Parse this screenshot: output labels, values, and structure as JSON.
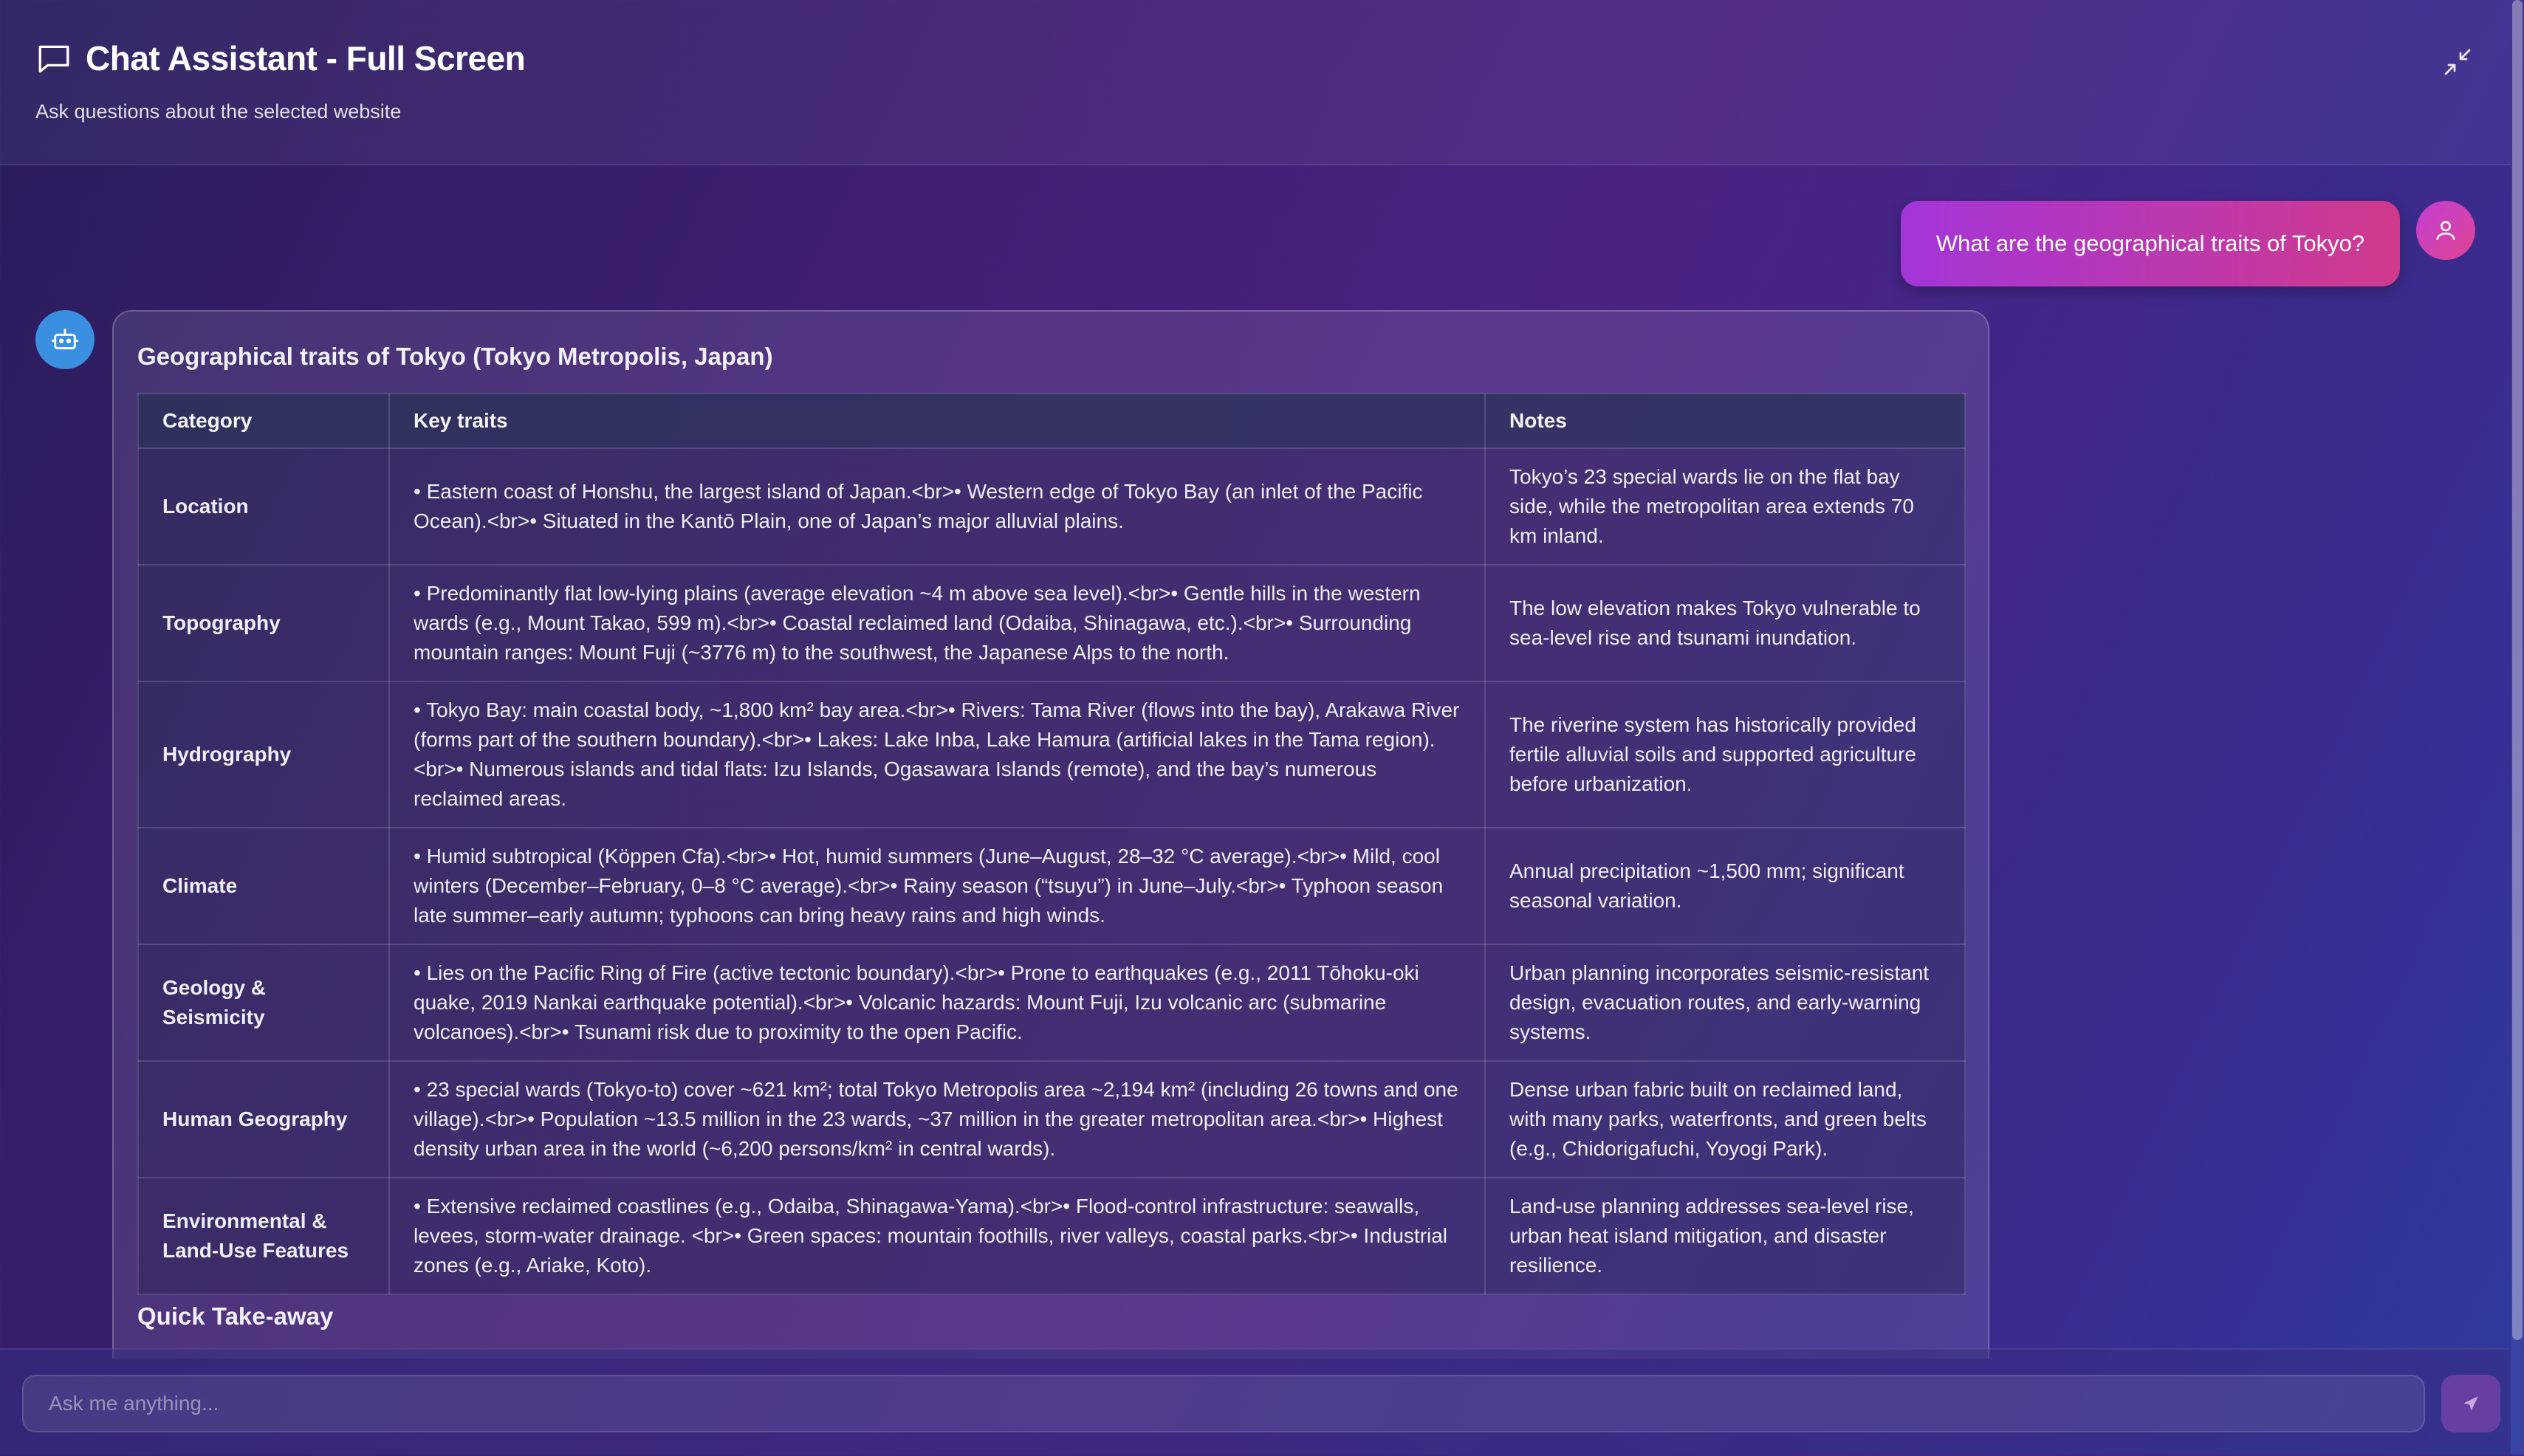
{
  "header": {
    "title": "Chat Assistant - Full Screen",
    "subtitle": "Ask questions about the selected website",
    "chat_icon": "chat-bubble-icon",
    "collapse_icon": "minimize-icon"
  },
  "user_message": {
    "text": "What are the geographical traits of Tokyo?",
    "avatar_icon": "user-icon"
  },
  "assistant_message": {
    "avatar_icon": "bot-icon",
    "title": "Geographical traits of Tokyo (Tokyo Metropolis, Japan)",
    "table": {
      "headers": [
        "Category",
        "Key traits",
        "Notes"
      ],
      "rows": [
        {
          "category": "Location",
          "traits": "• Eastern coast of Honshu, the largest island of Japan.<br>• Western edge of Tokyo Bay (an inlet of the Pacific Ocean).<br>• Situated in the Kantō Plain, one of Japan’s major alluvial plains.",
          "notes": "Tokyo’s 23 special wards lie on the flat bay side, while the metropolitan area extends 70 km inland."
        },
        {
          "category": "Topography",
          "traits": "• Predominantly flat low-lying plains (average elevation ~4 m above sea level).<br>• Gentle hills in the western wards (e.g., Mount Takao, 599 m).<br>• Coastal reclaimed land (Odaiba, Shinagawa, etc.).<br>• Surrounding mountain ranges: Mount Fuji (~3776 m) to the southwest, the Japanese Alps to the north.",
          "notes": "The low elevation makes Tokyo vulnerable to sea-level rise and tsunami inundation."
        },
        {
          "category": "Hydrography",
          "traits": "• Tokyo Bay: main coastal body, ~1,800 km² bay area.<br>• Rivers: Tama River (flows into the bay), Arakawa River (forms part of the southern boundary).<br>• Lakes: Lake Inba, Lake Hamura (artificial lakes in the Tama region).<br>• Numerous islands and tidal flats: Izu Islands, Ogasawara Islands (remote), and the bay’s numerous reclaimed areas.",
          "notes": "The riverine system has historically provided fertile alluvial soils and supported agriculture before urbanization."
        },
        {
          "category": "Climate",
          "traits": "• Humid subtropical (Köppen Cfa).<br>• Hot, humid summers (June–August, 28–32 °C average).<br>• Mild, cool winters (December–February, 0–8 °C average).<br>• Rainy season (“tsuyu”) in June–July.<br>• Typhoon season late summer–early autumn; typhoons can bring heavy rains and high winds.",
          "notes": "Annual precipitation ~1,500 mm; significant seasonal variation."
        },
        {
          "category": "Geology & Seismicity",
          "traits": "• Lies on the Pacific Ring of Fire (active tectonic boundary).<br>• Prone to earthquakes (e.g., 2011 Tōhoku-oki quake, 2019 Nankai earthquake potential).<br>• Volcanic hazards: Mount Fuji, Izu volcanic arc (submarine volcanoes).<br>• Tsunami risk due to proximity to the open Pacific.",
          "notes": "Urban planning incorporates seismic-resistant design, evacuation routes, and early-warning systems."
        },
        {
          "category": "Human Geography",
          "traits": "• 23 special wards (Tokyo-to) cover ~621 km²; total Tokyo Metropolis area ~2,194 km² (including 26 towns and one village).<br>• Population ~13.5 million in the 23 wards, ~37 million in the greater metropolitan area.<br>• Highest density urban area in the world (~6,200 persons/km² in central wards).",
          "notes": "Dense urban fabric built on reclaimed land, with many parks, waterfronts, and green belts (e.g., Chidorigafuchi, Yoyogi Park)."
        },
        {
          "category": "Environmental & Land-Use Features",
          "traits": "• Extensive reclaimed coastlines (e.g., Odaiba, Shinagawa-Yama).<br>• Flood-control infrastructure: seawalls, levees, storm-water drainage. <br>• Green spaces: mountain foothills, river valleys, coastal parks.<br>• Industrial zones (e.g., Ariake, Koto).",
          "notes": "Land-use planning addresses sea-level rise, urban heat island mitigation, and disaster resilience."
        }
      ]
    },
    "section_heading": "Quick Take-away"
  },
  "composer": {
    "placeholder": "Ask me anything...",
    "value": "",
    "send_icon": "send-icon"
  }
}
